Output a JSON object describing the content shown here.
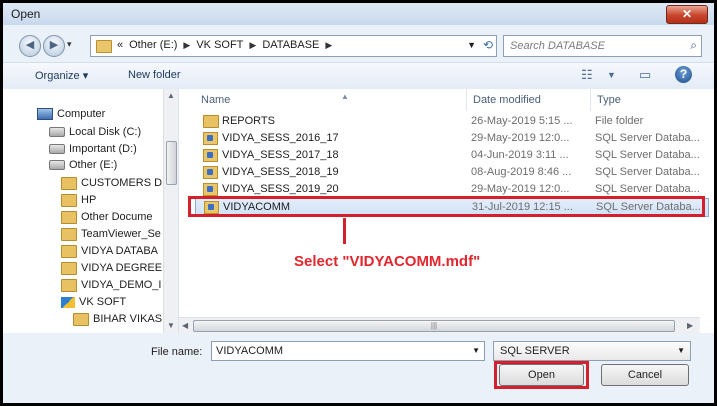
{
  "window": {
    "title": "Open",
    "close_glyph": "✕"
  },
  "address_bar": {
    "breadcrumbs": [
      "«",
      "Other (E:)",
      "VK SOFT",
      "DATABASE"
    ],
    "search_placeholder": "Search DATABASE"
  },
  "toolbar": {
    "organize_label": "Organize ▾",
    "new_folder_label": "New folder"
  },
  "nav_pane": {
    "items": [
      {
        "label": "Computer",
        "icon": "computer-icon"
      },
      {
        "label": "Local Disk (C:)",
        "icon": "drive-icon"
      },
      {
        "label": "Important (D:)",
        "icon": "drive-icon"
      },
      {
        "label": "Other (E:)",
        "icon": "drive-icon"
      },
      {
        "label": "CUSTOMERS D",
        "icon": "folder-icon"
      },
      {
        "label": "HP",
        "icon": "folder-icon"
      },
      {
        "label": "Other Docume",
        "icon": "folder-icon"
      },
      {
        "label": "TeamViewer_Se",
        "icon": "folder-icon"
      },
      {
        "label": "VIDYA DATABA",
        "icon": "folder-icon"
      },
      {
        "label": "VIDYA DEGREE",
        "icon": "folder-icon"
      },
      {
        "label": "VIDYA_DEMO_I",
        "icon": "folder-icon"
      },
      {
        "label": "VK SOFT",
        "icon": "vk-soft-icon"
      },
      {
        "label": "BIHAR VIKAS",
        "icon": "folder-icon"
      }
    ]
  },
  "file_list": {
    "columns": {
      "name": "Name",
      "date": "Date modified",
      "type": "Type"
    },
    "rows": [
      {
        "name": "REPORTS",
        "date": "26-May-2019 5:15 ...",
        "type": "File folder",
        "icon": "folder-icon"
      },
      {
        "name": "VIDYA_SESS_2016_17",
        "date": "29-May-2019 12:0...",
        "type": "SQL Server Databa...",
        "icon": "database-file-icon"
      },
      {
        "name": "VIDYA_SESS_2017_18",
        "date": "04-Jun-2019 3:11 ...",
        "type": "SQL Server Databa...",
        "icon": "database-file-icon"
      },
      {
        "name": "VIDYA_SESS_2018_19",
        "date": "08-Aug-2019 8:46 ...",
        "type": "SQL Server Databa...",
        "icon": "database-file-icon"
      },
      {
        "name": "VIDYA_SESS_2019_20",
        "date": "29-May-2019 12:0...",
        "type": "SQL Server Databa...",
        "icon": "database-file-icon"
      },
      {
        "name": "VIDYACOMM",
        "date": "31-Jul-2019 12:15 ...",
        "type": "SQL Server Databa...",
        "icon": "database-file-icon",
        "selected": true
      }
    ]
  },
  "annotation": {
    "text": "Select \"VIDYACOMM.mdf\"",
    "color": "#e2262e"
  },
  "footer": {
    "file_name_label": "File name:",
    "file_name_value": "VIDYACOMM",
    "file_type_value": "SQL SERVER",
    "open_label": "Open",
    "cancel_label": "Cancel"
  }
}
